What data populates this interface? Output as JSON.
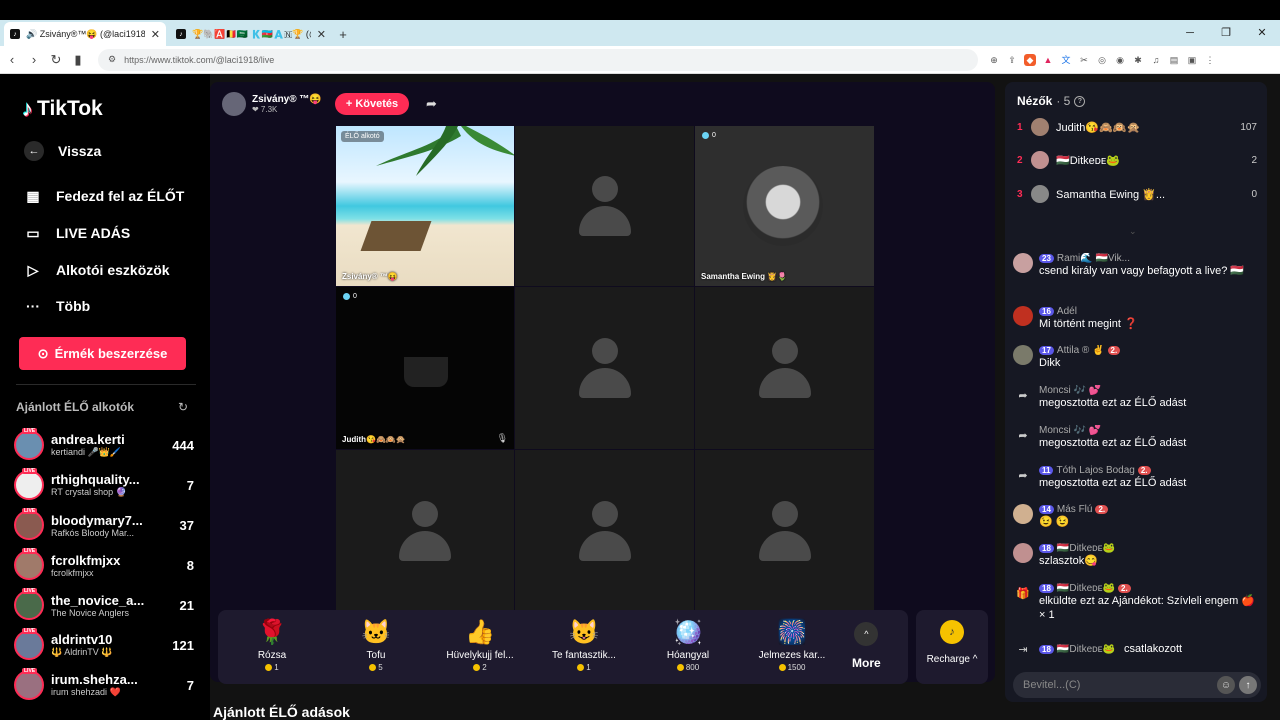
{
  "browser": {
    "tabs": [
      {
        "title": "🔊 Zsivány®™😝 (@laci1918) É...",
        "active": true
      },
      {
        "title": "🏆🐘🅰️🇧🇪🇸🇦 🇰🇦🇿🇦🇳🏆 (@csby0...",
        "active": false
      }
    ],
    "new_tab": "+",
    "url": "https://www.tiktok.com/@laci1918/live"
  },
  "sidebar": {
    "logo": "TikTok",
    "back": "Vissza",
    "nav": [
      "Fedezd fel az ÉLŐT",
      "LIVE ADÁS",
      "Alkotói eszközök",
      "Több"
    ],
    "coins_button": "Érmék beszerzése",
    "recommended_title": "Ajánlott ÉLŐ alkotók",
    "live_badge": "LIVE",
    "recommended": [
      {
        "name": "andrea.kerti",
        "sub": "kertiandi 🎤👑🖌️",
        "count": "444"
      },
      {
        "name": "rthighquality...",
        "sub": "RT crystal shop 🔮",
        "count": "7"
      },
      {
        "name": "bloodymary7...",
        "sub": "Rafkós Bloody Mar...",
        "count": "37"
      },
      {
        "name": "fcrolkfmjxx",
        "sub": "fcrolkfmjxx",
        "count": "8"
      },
      {
        "name": "the_novice_a...",
        "sub": "The Novice Anglers",
        "count": "21"
      },
      {
        "name": "aldrintv10",
        "sub": "🔱 AldrinTV 🔱",
        "count": "121"
      },
      {
        "name": "irum.shehza...",
        "sub": "irum shehzadi ❤️",
        "count": "7"
      }
    ]
  },
  "stream": {
    "host_name": "Zsivány® ™😝",
    "host_likes": "❤ 7.3K",
    "follow": "+ Követés",
    "creator_label": "ÉLŐ alkotó",
    "cells": [
      {
        "label": "Zsivány® ™😝"
      },
      {
        "label": ""
      },
      {
        "label": "Samantha Ewing 👸🌷",
        "viewers": "0"
      },
      {
        "label": "Judith😘🙈🙉🙊",
        "viewers": "0"
      }
    ],
    "gifts": [
      {
        "name": "Rózsa",
        "price": "1",
        "icon": "🌹"
      },
      {
        "name": "Tofu",
        "price": "5",
        "icon": "🐱"
      },
      {
        "name": "Hüvelykujj fel...",
        "price": "2",
        "icon": "👍"
      },
      {
        "name": "Te fantasztik...",
        "price": "1",
        "icon": "😺"
      },
      {
        "name": "Hóangyal",
        "price": "800",
        "icon": "🪩"
      },
      {
        "name": "Jelmezes kar...",
        "price": "1500",
        "icon": "🎆"
      }
    ],
    "more": "More",
    "recharge": "Recharge ^",
    "bottom_title": "Ajánlott ÉLŐ adások"
  },
  "viewers": {
    "title": "Nézők",
    "count": "· 5",
    "list": [
      {
        "rank": "1",
        "name": "Judith😘🙈🙉🙊",
        "score": "107"
      },
      {
        "rank": "2",
        "name": "🇭🇺Ditkeᴅᴇ🐸",
        "score": "2"
      },
      {
        "rank": "3",
        "name": "Samantha Ewing 👸...",
        "score": "0"
      }
    ]
  },
  "chat": [
    {
      "lvl": "23",
      "fan": "",
      "name": "Rami🌊 🇭🇺Vik...",
      "msg": "csend király van vagy befagyott a live? 🇭🇺"
    },
    {
      "lvl": "16",
      "fan": "",
      "name": "Adél",
      "msg": "Mi történt megint ❓"
    },
    {
      "lvl": "17",
      "fan": "2.",
      "name": "Attila ® ✌️",
      "msg": "Dikk"
    },
    {
      "lvl": "",
      "fan": "",
      "name": "Moncsi 🎶 💕",
      "msg": "megosztotta ezt az ÉLŐ adást"
    },
    {
      "lvl": "",
      "fan": "",
      "name": "Moncsi 🎶 💕",
      "msg": "megosztotta ezt az ÉLŐ adást"
    },
    {
      "lvl": "11",
      "fan": "2.",
      "name": "Tóth Lajos Bodag",
      "msg": "megosztotta ezt az ÉLŐ adást"
    },
    {
      "lvl": "14",
      "fan": "2.",
      "name": "Más Flú",
      "msg": "😉 😉"
    },
    {
      "lvl": "18",
      "fan": "",
      "name": "🇭🇺Ditkeᴅᴇ🐸",
      "msg": "szlasztok😋"
    },
    {
      "lvl": "18",
      "fan": "2.",
      "name": "🇭🇺Ditkeᴅᴇ🐸",
      "msg": "elküldte ezt az Ajándékot: Szívleli engem 🍎 × 1"
    },
    {
      "lvl": "18",
      "fan": "",
      "name": "🇭🇺Ditkeᴅᴇ🐸",
      "msg": "csatlakozott"
    }
  ],
  "input": {
    "placeholder": "Bevitel...(C)"
  }
}
